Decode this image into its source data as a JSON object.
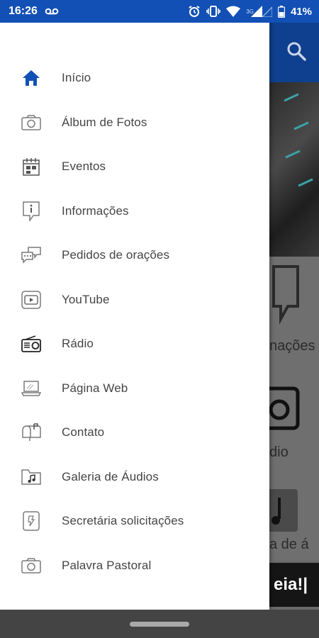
{
  "status_bar": {
    "time": "16:26",
    "network_label": "3G",
    "battery": "41%",
    "icons": [
      "voicemail-icon",
      "alarm-icon",
      "vibrate-icon",
      "wifi-icon",
      "signal-icon",
      "battery-icon"
    ]
  },
  "header": {
    "search_icon": "search-icon"
  },
  "background": {
    "label_1": "nações",
    "label_2": "dio",
    "label_3": "a de á",
    "banner_text": "eia!|"
  },
  "drawer": {
    "items": [
      {
        "label": "Início",
        "icon": "home-icon"
      },
      {
        "label": "Álbum de Fotos",
        "icon": "camera-icon"
      },
      {
        "label": "Eventos",
        "icon": "calendar-icon"
      },
      {
        "label": "Informações",
        "icon": "info-icon"
      },
      {
        "label": "Pedidos de orações",
        "icon": "chat-icon"
      },
      {
        "label": "YouTube",
        "icon": "youtube-icon"
      },
      {
        "label": "Rádio",
        "icon": "radio-icon"
      },
      {
        "label": "Página Web",
        "icon": "laptop-icon"
      },
      {
        "label": "Contato",
        "icon": "mailbox-icon"
      },
      {
        "label": "Galeria de Áudios",
        "icon": "music-folder-icon"
      },
      {
        "label": "Secretária solicitações",
        "icon": "document-icon"
      },
      {
        "label": "Palavra Pastoral",
        "icon": "camera-icon"
      }
    ]
  },
  "colors": {
    "accent": "#1250b5",
    "header": "#0f3f8f",
    "icon": "#7a7a7a",
    "active_icon": "#1250b5",
    "text": "#454545"
  }
}
